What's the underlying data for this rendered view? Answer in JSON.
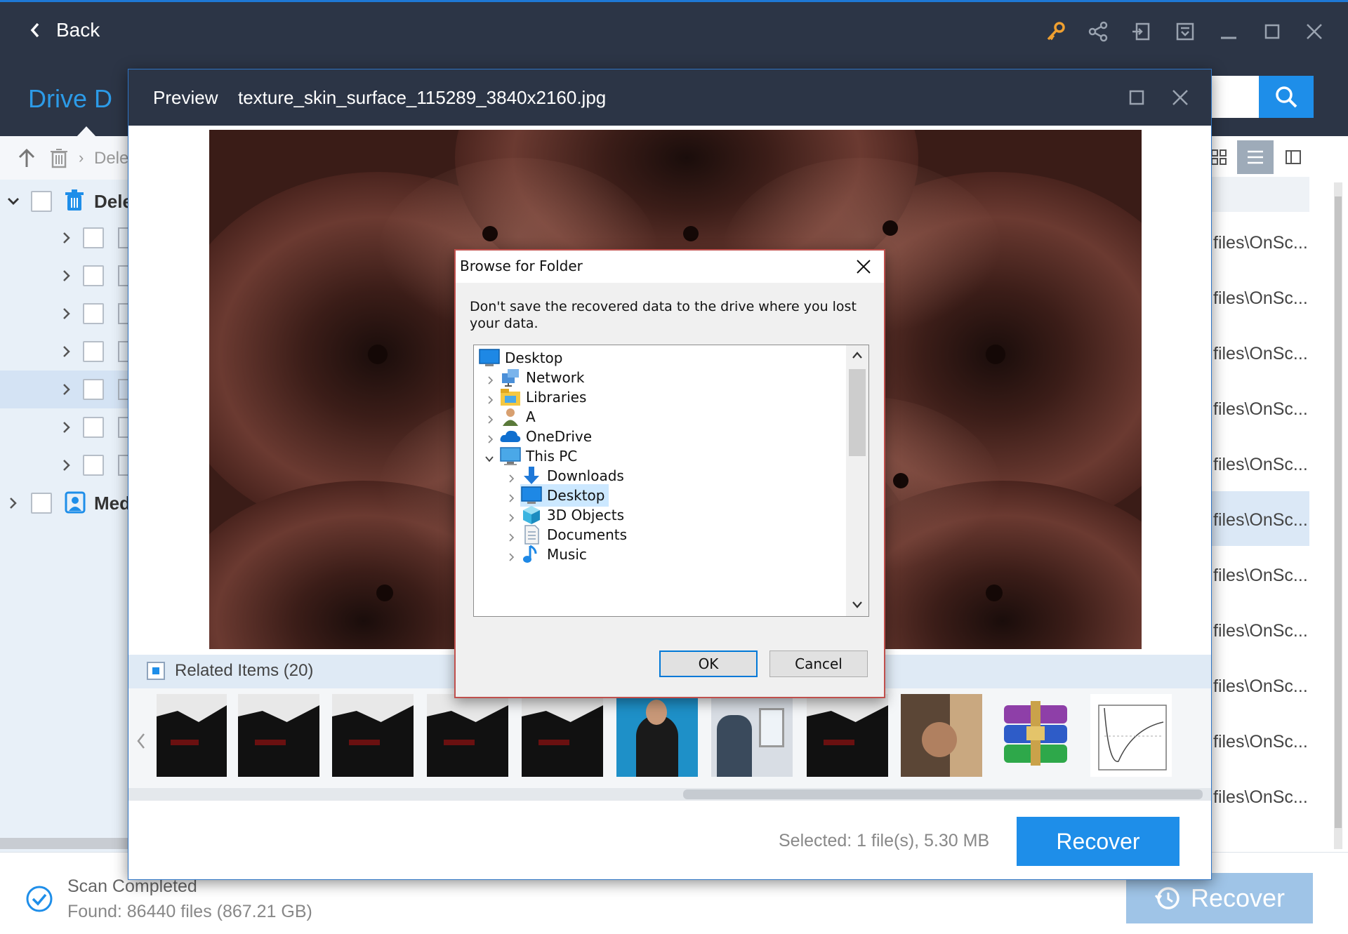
{
  "titlebar": {
    "back_label": "Back"
  },
  "header": {
    "drive_title": "Drive D",
    "search_placeholder": ""
  },
  "left_pane": {
    "breadcrumb": "Dele",
    "root_label": "Dele",
    "media_label": "Med"
  },
  "right_pane": {
    "paths": [
      "files\\OnSc...",
      "files\\OnSc...",
      "files\\OnSc...",
      "files\\OnSc...",
      "files\\OnSc...",
      "files\\OnSc...",
      "files\\OnSc...",
      "files\\OnSc...",
      "files\\OnSc...",
      "files\\OnSc...",
      "files\\OnSc..."
    ]
  },
  "status": {
    "line1": "Scan Completed",
    "line2": "Found: 86440 files (867.21 GB)",
    "recover_label": "Recover"
  },
  "preview": {
    "label": "Preview",
    "filename": "texture_skin_surface_115289_3840x2160.jpg",
    "related_label": "Related Items (20)",
    "selected_text": "Selected: 1 file(s), 5.30 MB",
    "recover_label": "Recover"
  },
  "dialog": {
    "title": "Browse for Folder",
    "message": "Don't save the recovered data to the drive where you lost your data.",
    "tree": [
      {
        "label": "Desktop",
        "icon": "desktop-icon",
        "level": 0
      },
      {
        "label": "Network",
        "icon": "network-icon",
        "level": 1
      },
      {
        "label": "Libraries",
        "icon": "libraries-icon",
        "level": 1
      },
      {
        "label": "A",
        "icon": "user-icon",
        "level": 1
      },
      {
        "label": "OneDrive",
        "icon": "cloud-icon",
        "level": 1
      },
      {
        "label": "This PC",
        "icon": "computer-icon",
        "level": 1
      },
      {
        "label": "Downloads",
        "icon": "downloads-icon",
        "level": 2
      },
      {
        "label": "Desktop",
        "icon": "desktop-icon",
        "level": 2
      },
      {
        "label": "3D Objects",
        "icon": "cube-icon",
        "level": 2
      },
      {
        "label": "Documents",
        "icon": "document-icon",
        "level": 2
      },
      {
        "label": "Music",
        "icon": "music-icon",
        "level": 2
      }
    ],
    "ok_label": "OK",
    "cancel_label": "Cancel"
  },
  "colors": {
    "accent": "#1e8ee9",
    "dark": "#2c3546",
    "drive_title": "#2c9be8",
    "dialog_border": "#c0504d"
  }
}
